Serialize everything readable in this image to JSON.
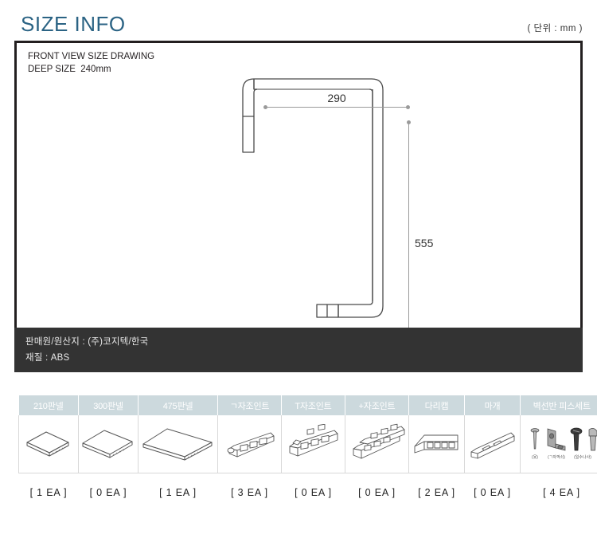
{
  "header": {
    "title": "SIZE INFO",
    "unit_note": "( 단위 : mm )"
  },
  "drawing": {
    "caption_line1": "FRONT VIEW SIZE DRAWING",
    "caption_line2": "DEEP SIZE  240mm",
    "width_dimension": "290",
    "height_dimension": "555"
  },
  "info_bar": {
    "line1": "판매원/원산지 : (주)코지텍/한국",
    "line2": "재질 : ABS"
  },
  "parts": {
    "columns": [
      {
        "label": "210판넬",
        "icon": "flat-panel-small-icon",
        "qty": "[ 1 EA ]"
      },
      {
        "label": "300판넬",
        "icon": "flat-panel-medium-icon",
        "qty": "[ 0 EA ]"
      },
      {
        "label": "475판넬",
        "icon": "flat-panel-large-icon",
        "qty": "[ 1 EA ]"
      },
      {
        "label": "ㄱ자조인트",
        "icon": "corner-joint-icon",
        "qty": "[ 3 EA ]"
      },
      {
        "label": "T자조인트",
        "icon": "tee-joint-icon",
        "qty": "[ 0 EA ]"
      },
      {
        "label": "+자조인트",
        "icon": "cross-joint-icon",
        "qty": "[ 0 EA ]"
      },
      {
        "label": "다리캡",
        "icon": "leg-cap-icon",
        "qty": "[ 2 EA ]"
      },
      {
        "label": "마개",
        "icon": "end-plug-icon",
        "qty": "[ 0 EA ]"
      },
      {
        "label": "벽선반 피스세트",
        "icon": "screw-set-icon",
        "qty": "[ 4 EA ]"
      }
    ],
    "screw_set_captions": [
      "(못)",
      "(ㄱ자꺽쇠)",
      "(일수나사)"
    ]
  },
  "colors": {
    "title": "#2b6384",
    "panel_border": "#231f20",
    "info_bar_bg": "#333333",
    "table_header_bg": "#ccd9dd",
    "dimension_line": "#9a9a9a"
  }
}
